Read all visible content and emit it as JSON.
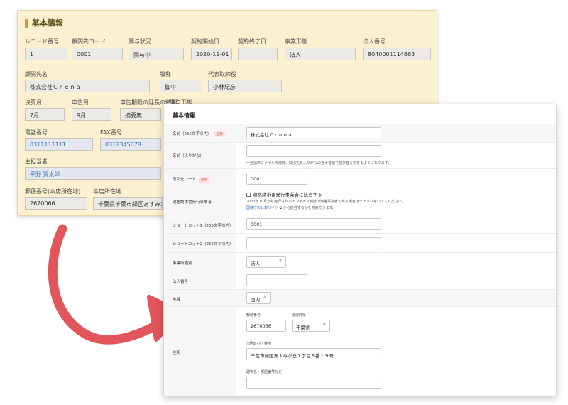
{
  "back": {
    "title": "基本情報",
    "fields": {
      "record_no": {
        "label": "レコード番号",
        "value": "1"
      },
      "advisor_code": {
        "label": "顧問先コード",
        "value": "0001"
      },
      "relation": {
        "label": "関与状況",
        "value": "関与中"
      },
      "contract_start": {
        "label": "契約開始日",
        "value": "2020-11-01"
      },
      "contract_end": {
        "label": "契約終了日",
        "value": ""
      },
      "business_type": {
        "label": "事業形態",
        "value": "法人"
      },
      "corp_no": {
        "label": "法人番号",
        "value": "8040001114663"
      },
      "client_name": {
        "label": "顧問先名",
        "value": "株式会社Ｃｒｅｎａ"
      },
      "honorific": {
        "label": "敬称",
        "value": "御中"
      },
      "representative": {
        "label": "代表取締役",
        "value": "小林紀彦"
      },
      "fiscal_month": {
        "label": "決算月",
        "value": "7月"
      },
      "filing_month": {
        "label": "申告月",
        "value": "9月"
      },
      "extension": {
        "label": "申告期限の延長の特例",
        "value": "摘要無"
      },
      "relation_type": {
        "label": "関与形態",
        "value": ""
      },
      "phone": {
        "label": "電話番号",
        "value": "0311111111"
      },
      "fax": {
        "label": "FAX番号",
        "value": "0312345678"
      },
      "staff": {
        "label": "主担当者",
        "value": "平野 賢太郎"
      },
      "postal": {
        "label": "郵便番号(本店所在地)",
        "value": "2670066"
      },
      "hq_address": {
        "label": "本店所在地",
        "value": "千葉県千葉市緑区あすみが丘"
      }
    }
  },
  "front": {
    "title": "基本情報",
    "name": {
      "label": "名前（255文字以内）",
      "required": "必須",
      "value": "株式会社Ｃｒｅｎａ"
    },
    "kana": {
      "label": "名前（ふりがな）",
      "value": "",
      "help": "一括請求ファイル作成時、取引先をふりがなの五十音順で並び替えできるようになります。"
    },
    "client_code": {
      "label": "取引先コード",
      "required": "必須",
      "value": "0001"
    },
    "invoice": {
      "label": "適格請求書発行事業者",
      "checkbox_label": "適格請求書発行事業者に該当する",
      "help1": "2023年10月から施行されるインボイス制度の適格事業者である場合はチェックをつけてください。",
      "help_link": "国税庁の公表サイト",
      "help2": "から該当するかを検索できます。"
    },
    "shortcut1": {
      "label": "ショートカット1（255文字以内）",
      "value": "0001"
    },
    "shortcut2": {
      "label": "ショートカット2（255文字以内）",
      "value": ""
    },
    "office_type": {
      "label": "事業所種別",
      "value": "法人"
    },
    "corp_no": {
      "label": "法人番号",
      "value": ""
    },
    "region": {
      "label": "地域",
      "value": "国内"
    },
    "address": {
      "label": "住所",
      "postal_label": "郵便番号",
      "postal_value": "2670066",
      "pref_label": "都道府県",
      "pref_value": "千葉県",
      "city_label": "市区町村・番地",
      "city_value": "千葉市緑区あすみが丘７丁目６番１９号",
      "building_label": "建物名・部屋番号など",
      "building_value": ""
    }
  },
  "colors": {
    "arrow": "#e0565b",
    "back_bg": "#fbf1d0",
    "accent": "#c9a227"
  }
}
